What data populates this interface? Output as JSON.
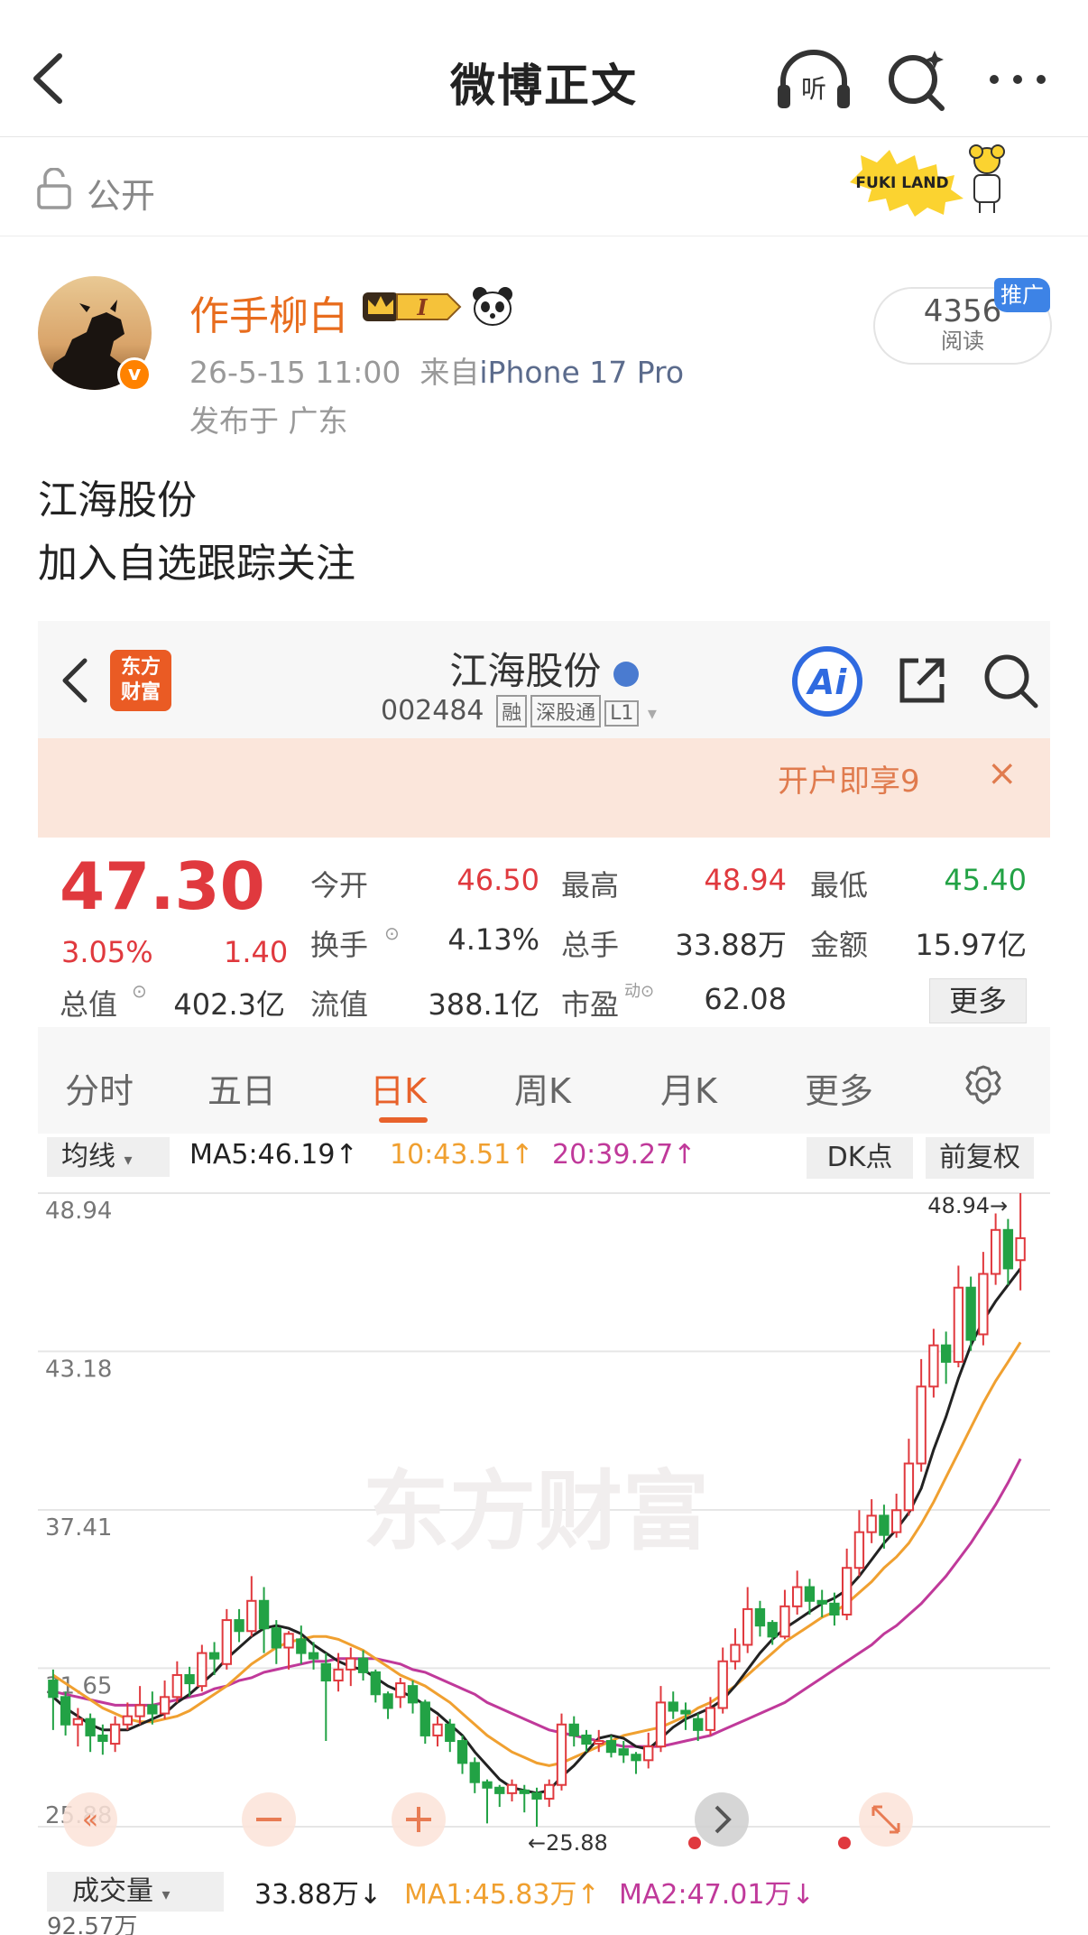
{
  "nav": {
    "title": "微博正文",
    "listen_label": "听"
  },
  "visibility": {
    "label": "公开",
    "sticker_text": "FUKI LAND"
  },
  "author": {
    "name": "作手柳白",
    "badge_text": "I",
    "verified_mark": "v",
    "time": "26-5-15 11:00",
    "source_prefix": "来自",
    "device": "iPhone 17 Pro",
    "location": "发布于 广东"
  },
  "reads": {
    "count": "4356",
    "label": "阅读",
    "promo": "推广"
  },
  "post": {
    "lines": [
      "江海股份",
      "加入自选跟踪关注"
    ]
  },
  "app": {
    "logo_text": [
      "东方",
      "财富"
    ],
    "stock_name": "江海股份",
    "stock_code": "002484",
    "tags": [
      "融",
      "深股通",
      "L1"
    ],
    "ai_label": "Ai",
    "banner_text": "开户即享9",
    "banner_close": "×",
    "watermark": "东方财富"
  },
  "quote": {
    "price": "47.30",
    "pct": "3.05%",
    "change": "1.40",
    "rows": [
      [
        {
          "label": "今开",
          "value": "46.50",
          "color": "red"
        },
        {
          "label": "最高",
          "value": "48.94",
          "color": "red"
        },
        {
          "label": "最低",
          "value": "45.40",
          "color": "green"
        }
      ],
      [
        {
          "label": "换手",
          "value": "4.13%",
          "color": "normal"
        },
        {
          "label": "总手",
          "value": "33.88万",
          "color": "normal"
        },
        {
          "label": "金额",
          "value": "15.97亿",
          "color": "normal"
        }
      ],
      [
        {
          "label": "总值",
          "value": "402.3亿",
          "color": "normal"
        },
        {
          "label": "流值",
          "value": "388.1亿",
          "color": "normal"
        },
        {
          "label": "市盈",
          "value": "62.08",
          "color": "normal"
        }
      ]
    ],
    "more": "更多"
  },
  "tabs": [
    "分时",
    "五日",
    "日K",
    "周K",
    "月K",
    "更多"
  ],
  "active_tab": "日K",
  "ma": {
    "select": "均线",
    "ma5": "MA5:46.19↑",
    "ma10": "10:43.51↑",
    "ma20": "20:39.27↑",
    "dk": "DK点",
    "fq": "前复权"
  },
  "volume": {
    "select": "成交量",
    "value": "33.88万↓",
    "ma1": "MA1:45.83万↑",
    "ma2": "MA2:47.01万↓",
    "max": "92.57万"
  },
  "colors": {
    "up": "#e0393e",
    "down": "#22a245",
    "ma5": "#222222",
    "ma10": "#f0a030",
    "ma20": "#c0399a",
    "accent": "#e8622b",
    "weibo_orange": "#ff8200"
  },
  "chart_data": {
    "type": "candlestick",
    "y_ticks": [
      "48.94",
      "43.18",
      "37.41",
      "31.65",
      "25.88"
    ],
    "ylim": [
      25.88,
      48.94
    ],
    "high_label": "48.94",
    "low_label": "25.88",
    "candles": [
      [
        31.2,
        30.6,
        31.6,
        29.4
      ],
      [
        30.6,
        29.6,
        30.8,
        29.2
      ],
      [
        29.6,
        29.8,
        30.2,
        28.8
      ],
      [
        29.8,
        29.2,
        30.0,
        28.6
      ],
      [
        29.2,
        29.0,
        29.6,
        28.5
      ],
      [
        28.9,
        29.6,
        29.9,
        28.6
      ],
      [
        29.6,
        29.9,
        30.4,
        29.4
      ],
      [
        29.9,
        30.3,
        31.0,
        29.6
      ],
      [
        30.3,
        30.0,
        30.8,
        29.6
      ],
      [
        30.0,
        30.6,
        31.2,
        29.8
      ],
      [
        30.6,
        31.4,
        31.9,
        30.4
      ],
      [
        31.4,
        31.1,
        31.7,
        30.6
      ],
      [
        31.0,
        32.2,
        32.5,
        30.8
      ],
      [
        32.2,
        32.0,
        32.6,
        31.4
      ],
      [
        31.8,
        33.4,
        33.8,
        31.6
      ],
      [
        33.4,
        33.0,
        33.8,
        32.6
      ],
      [
        33.0,
        34.1,
        35.0,
        32.8
      ],
      [
        34.1,
        33.1,
        34.6,
        32.2
      ],
      [
        33.1,
        32.4,
        33.4,
        31.8
      ],
      [
        32.4,
        32.9,
        33.0,
        31.6
      ],
      [
        32.7,
        32.2,
        33.2,
        31.8
      ],
      [
        32.2,
        32.0,
        32.6,
        31.6
      ],
      [
        31.8,
        31.2,
        32.2,
        29.0
      ],
      [
        31.2,
        31.6,
        32.2,
        30.8
      ],
      [
        31.6,
        32.0,
        32.4,
        31.0
      ],
      [
        32.0,
        31.5,
        32.3,
        31.2
      ],
      [
        31.5,
        30.7,
        31.6,
        30.4
      ],
      [
        30.7,
        30.2,
        30.8,
        29.8
      ],
      [
        30.6,
        31.1,
        31.3,
        30.2
      ],
      [
        31.0,
        30.4,
        31.2,
        30.0
      ],
      [
        30.4,
        29.2,
        30.5,
        28.9
      ],
      [
        29.2,
        29.6,
        29.9,
        28.8
      ],
      [
        29.6,
        29.0,
        29.8,
        28.6
      ],
      [
        29.0,
        28.2,
        29.2,
        27.8
      ],
      [
        28.2,
        27.5,
        28.4,
        27.1
      ],
      [
        27.5,
        27.3,
        27.6,
        26.0
      ],
      [
        27.3,
        27.1,
        27.4,
        26.6
      ],
      [
        27.1,
        27.4,
        27.6,
        26.8
      ],
      [
        27.2,
        27.1,
        27.4,
        26.4
      ],
      [
        27.1,
        26.9,
        27.3,
        25.88
      ],
      [
        26.9,
        27.4,
        27.6,
        26.6
      ],
      [
        27.4,
        29.6,
        30.0,
        27.2
      ],
      [
        29.6,
        29.2,
        29.9,
        28.8
      ],
      [
        29.2,
        28.9,
        29.4,
        28.6
      ],
      [
        28.9,
        29.0,
        29.4,
        28.6
      ],
      [
        29.0,
        28.6,
        29.2,
        28.4
      ],
      [
        28.7,
        28.5,
        29.0,
        28.2
      ],
      [
        28.5,
        28.3,
        28.6,
        27.8
      ],
      [
        28.3,
        28.8,
        29.3,
        28.0
      ],
      [
        28.8,
        30.4,
        31.0,
        28.6
      ],
      [
        30.4,
        30.1,
        30.8,
        29.8
      ],
      [
        30.1,
        30.0,
        30.4,
        29.4
      ],
      [
        29.8,
        29.4,
        30.0,
        29.0
      ],
      [
        29.4,
        30.2,
        30.6,
        29.2
      ],
      [
        30.2,
        31.9,
        32.4,
        30.0
      ],
      [
        31.9,
        32.5,
        33.1,
        31.6
      ],
      [
        32.5,
        33.8,
        34.6,
        32.2
      ],
      [
        33.8,
        33.2,
        34.1,
        32.8
      ],
      [
        33.3,
        32.8,
        33.4,
        32.5
      ],
      [
        32.8,
        33.9,
        34.5,
        32.7
      ],
      [
        33.9,
        34.6,
        35.2,
        33.6
      ],
      [
        34.6,
        34.1,
        34.9,
        33.6
      ],
      [
        34.1,
        34.0,
        34.5,
        33.5
      ],
      [
        34.0,
        33.6,
        34.4,
        33.2
      ],
      [
        33.6,
        35.3,
        36.0,
        33.4
      ],
      [
        35.3,
        36.6,
        37.4,
        35.0
      ],
      [
        36.6,
        37.2,
        37.8,
        36.2
      ],
      [
        37.2,
        36.5,
        37.6,
        36.0
      ],
      [
        36.6,
        37.4,
        38.0,
        36.4
      ],
      [
        37.4,
        39.1,
        40.0,
        37.2
      ],
      [
        39.1,
        41.9,
        42.9,
        38.8
      ],
      [
        41.9,
        43.4,
        44.0,
        41.5
      ],
      [
        43.4,
        42.8,
        43.9,
        42.0
      ],
      [
        42.8,
        45.5,
        46.3,
        42.6
      ],
      [
        45.5,
        43.6,
        45.9,
        43.2
      ],
      [
        43.8,
        46.0,
        46.8,
        43.4
      ],
      [
        46.0,
        47.6,
        48.2,
        45.6
      ],
      [
        47.6,
        46.2,
        48.0,
        45.6
      ],
      [
        46.5,
        47.3,
        48.94,
        45.4
      ]
    ],
    "ma5": [
      30.6,
      30.2,
      29.9,
      29.6,
      29.4,
      29.4,
      29.4,
      29.6,
      29.8,
      30.0,
      30.4,
      30.7,
      31.1,
      31.5,
      32.0,
      32.4,
      32.8,
      33.1,
      33.2,
      33.1,
      32.9,
      32.5,
      32.2,
      31.9,
      31.7,
      31.6,
      31.3,
      31.0,
      30.8,
      30.6,
      30.3,
      30.0,
      29.6,
      29.2,
      28.6,
      28.1,
      27.6,
      27.3,
      27.2,
      27.1,
      27.2,
      27.7,
      28.1,
      28.6,
      29.1,
      29.2,
      29.1,
      28.8,
      28.7,
      29.1,
      29.5,
      29.8,
      30.0,
      30.2,
      30.5,
      31.0,
      31.6,
      32.2,
      32.7,
      33.1,
      33.4,
      33.7,
      34.0,
      34.2,
      34.5,
      35.0,
      35.6,
      36.2,
      36.7,
      37.3,
      38.2,
      39.6,
      40.8,
      42.2,
      43.4,
      44.3,
      45.0,
      45.6,
      46.19
    ],
    "ma10": [
      31.4,
      31.1,
      30.8,
      30.5,
      30.2,
      30.0,
      29.8,
      29.7,
      29.7,
      29.8,
      29.9,
      30.1,
      30.4,
      30.7,
      31.0,
      31.4,
      31.8,
      32.1,
      32.4,
      32.6,
      32.7,
      32.8,
      32.8,
      32.7,
      32.5,
      32.3,
      32.0,
      31.7,
      31.4,
      31.2,
      31.0,
      30.7,
      30.4,
      30.0,
      29.6,
      29.2,
      28.9,
      28.6,
      28.4,
      28.2,
      28.1,
      28.2,
      28.4,
      28.6,
      28.8,
      29.0,
      29.2,
      29.3,
      29.4,
      29.5,
      29.7,
      29.9,
      30.2,
      30.4,
      30.7,
      31.0,
      31.4,
      31.8,
      32.2,
      32.6,
      32.9,
      33.2,
      33.5,
      33.7,
      34.0,
      34.4,
      34.8,
      35.3,
      35.7,
      36.2,
      36.9,
      37.7,
      38.6,
      39.5,
      40.4,
      41.3,
      42.1,
      42.8,
      43.51
    ],
    "ma20": [
      30.8,
      30.7,
      30.6,
      30.5,
      30.4,
      30.3,
      30.3,
      30.3,
      30.3,
      30.4,
      30.5,
      30.6,
      30.7,
      30.9,
      31.0,
      31.2,
      31.3,
      31.5,
      31.6,
      31.7,
      31.8,
      31.9,
      31.9,
      32.0,
      32.0,
      32.0,
      32.0,
      31.9,
      31.8,
      31.6,
      31.5,
      31.3,
      31.1,
      30.9,
      30.7,
      30.4,
      30.2,
      30.0,
      29.8,
      29.6,
      29.4,
      29.3,
      29.2,
      29.1,
      29.0,
      28.9,
      28.8,
      28.8,
      28.8,
      28.8,
      28.9,
      29.0,
      29.1,
      29.2,
      29.4,
      29.6,
      29.8,
      30.0,
      30.2,
      30.4,
      30.7,
      31.0,
      31.3,
      31.6,
      31.9,
      32.2,
      32.5,
      32.9,
      33.2,
      33.6,
      34.0,
      34.5,
      35.0,
      35.6,
      36.2,
      36.9,
      37.6,
      38.4,
      39.27
    ]
  }
}
